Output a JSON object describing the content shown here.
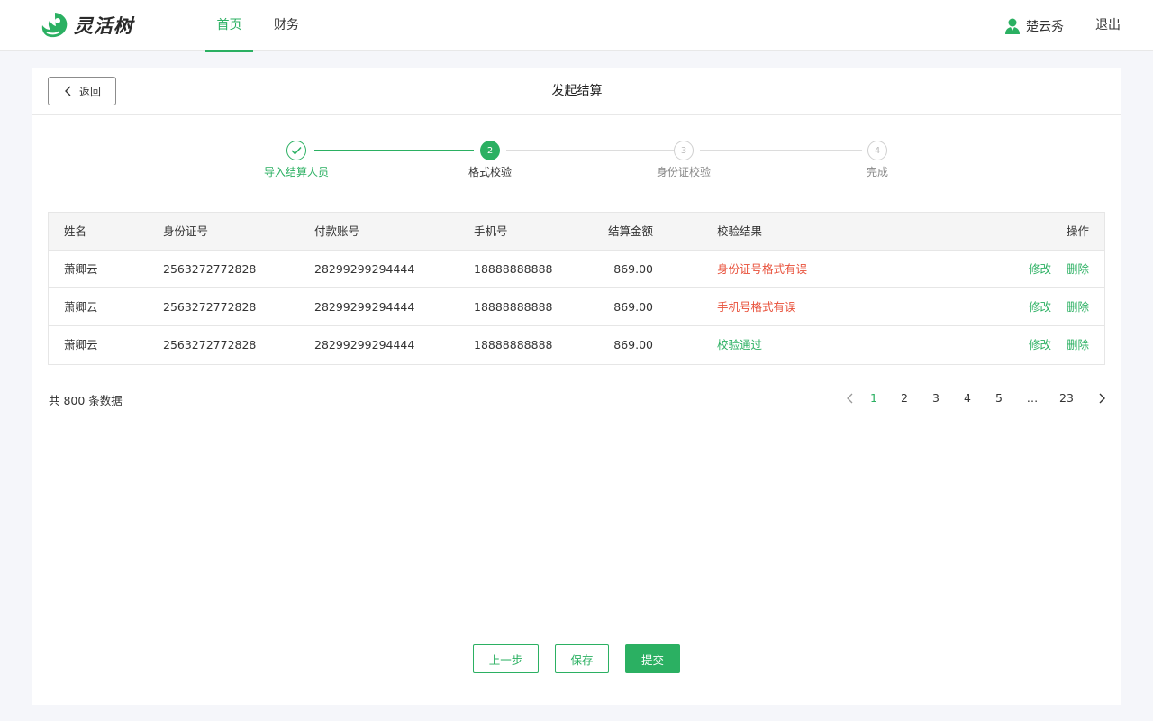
{
  "app": {
    "logo_text": "灵活树"
  },
  "nav": {
    "items": [
      {
        "label": "首页",
        "active": true
      },
      {
        "label": "财务",
        "active": false
      }
    ]
  },
  "user": {
    "name": "楚云秀",
    "logout": "退出"
  },
  "panel": {
    "back_label": "返回",
    "title": "发起结算"
  },
  "steps": [
    {
      "number": "",
      "label": "导入结算人员",
      "state": "done"
    },
    {
      "number": "2",
      "label": "格式校验",
      "state": "current"
    },
    {
      "number": "3",
      "label": "身份证校验",
      "state": "todo"
    },
    {
      "number": "4",
      "label": "完成",
      "state": "todo"
    }
  ],
  "table": {
    "headers": {
      "name": "姓名",
      "id_no": "身份证号",
      "account": "付款账号",
      "phone": "手机号",
      "amount": "结算金额",
      "result": "校验结果",
      "actions": "操作"
    },
    "rows": [
      {
        "name": "萧卿云",
        "id_no": "2563272772828",
        "account": "28299299294444",
        "phone": "18888888888",
        "amount": "869.00",
        "result": "身份证号格式有误",
        "status": "error",
        "edit": "修改",
        "delete": "删除"
      },
      {
        "name": "萧卿云",
        "id_no": "2563272772828",
        "account": "28299299294444",
        "phone": "18888888888",
        "amount": "869.00",
        "result": "手机号格式有误",
        "status": "error",
        "edit": "修改",
        "delete": "删除"
      },
      {
        "name": "萧卿云",
        "id_no": "2563272772828",
        "account": "28299299294444",
        "phone": "18888888888",
        "amount": "869.00",
        "result": "校验通过",
        "status": "ok",
        "edit": "修改",
        "delete": "删除"
      }
    ]
  },
  "pagination": {
    "total_text": "共 800 条数据",
    "pages": [
      "1",
      "2",
      "3",
      "4",
      "5",
      "…",
      "23"
    ],
    "current": "1"
  },
  "actions": {
    "prev": "上一步",
    "save": "保存",
    "submit": "提交"
  },
  "colors": {
    "accent": "#2bb062",
    "error": "#e8503a"
  },
  "icons": {
    "logo": "leaf-hand-logo-icon",
    "user": "user-avatar-icon",
    "back": "chevron-left-icon",
    "check": "check-icon",
    "prev_page": "chevron-left-icon",
    "next_page": "chevron-right-icon"
  }
}
